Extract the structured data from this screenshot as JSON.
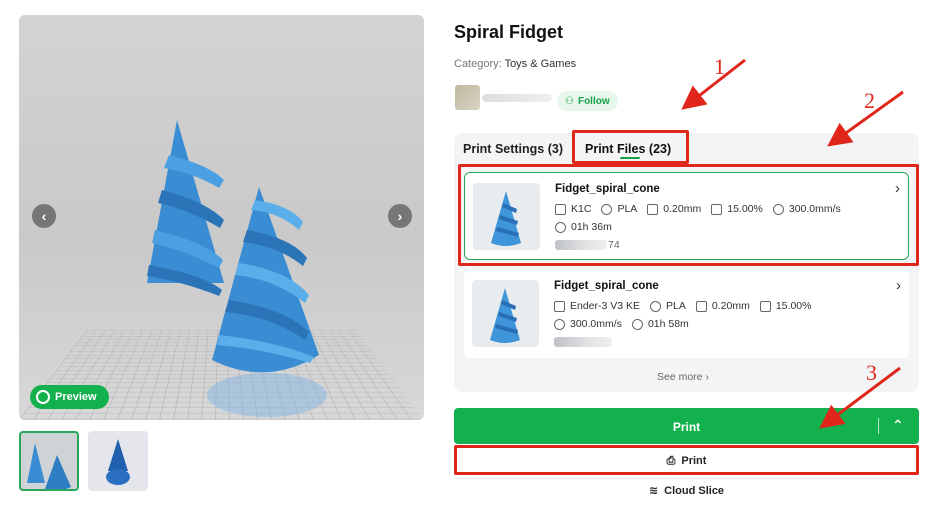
{
  "model": {
    "title": "Spiral Fidget",
    "category_label": "Category:",
    "category_value": "Toys & Games"
  },
  "gallery": {
    "preview_label": "Preview",
    "prev_icon": "chevron-left-icon",
    "next_icon": "chevron-right-icon"
  },
  "author": {
    "follow_label": "Follow"
  },
  "tabs": [
    {
      "label": "Print Settings (3)",
      "active": false
    },
    {
      "label": "Print Files (23)",
      "active": true
    }
  ],
  "print_files": [
    {
      "name": "Fidget_spiral_cone",
      "selected": true,
      "specs_row1": [
        {
          "icon": "printer-icon",
          "text": "K1C"
        },
        {
          "icon": "filament-icon",
          "text": "PLA"
        },
        {
          "icon": "layer-height-icon",
          "text": "0.20mm"
        },
        {
          "icon": "infill-icon",
          "text": "15.00%"
        },
        {
          "icon": "speed-icon",
          "text": "300.0mm/s"
        }
      ],
      "specs_row2": [
        {
          "icon": "clock-icon",
          "text": "01h 36m"
        }
      ],
      "blurred_suffix": "74"
    },
    {
      "name": "Fidget_spiral_cone",
      "selected": false,
      "specs_row1": [
        {
          "icon": "printer-icon",
          "text": "Ender-3 V3 KE"
        },
        {
          "icon": "filament-icon",
          "text": "PLA"
        },
        {
          "icon": "layer-height-icon",
          "text": "0.20mm"
        },
        {
          "icon": "infill-icon",
          "text": "15.00%"
        }
      ],
      "specs_row2": [
        {
          "icon": "speed-icon",
          "text": "300.0mm/s"
        },
        {
          "icon": "clock-icon",
          "text": "01h 58m"
        }
      ]
    }
  ],
  "see_more_label": "See more",
  "actions": {
    "print_main_label": "Print",
    "print_sub_label": "Print",
    "cloud_slice_label": "Cloud Slice"
  },
  "annotations": {
    "color": "#e0261a",
    "numbers": [
      "1",
      "2",
      "3"
    ]
  },
  "colors": {
    "accent": "#13b14d",
    "card_selected_border": "#2aa65a"
  }
}
